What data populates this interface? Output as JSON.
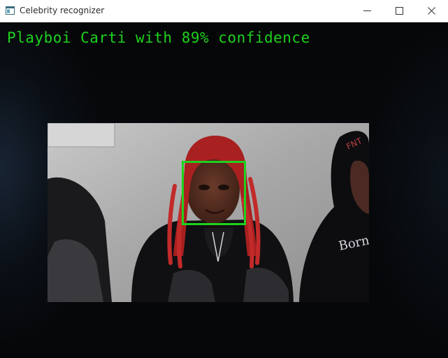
{
  "window": {
    "title": "Celebrity recognizer",
    "app_icon": "app-window-icon",
    "controls": [
      "minimize-icon",
      "maximize-icon",
      "close-icon"
    ]
  },
  "overlay": {
    "label": "Playboi Carti with 89% confidence",
    "name": "Playboi Carti",
    "confidence_percent": 89,
    "color": "#1ed21e"
  },
  "detection": {
    "box_color": "#1ed21e"
  }
}
